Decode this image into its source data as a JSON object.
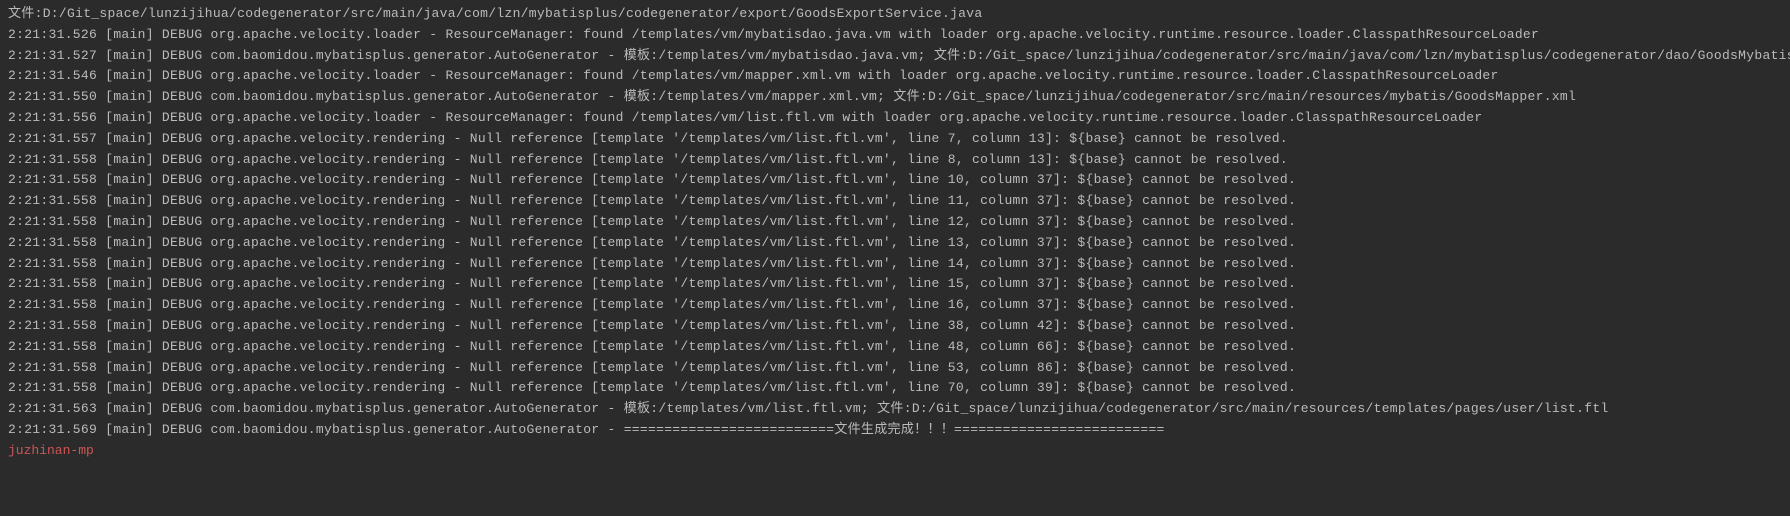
{
  "header": "文件:D:/Git_space/lunzijihua/codegenerator/src/main/java/com/lzn/mybatisplus/codegenerator/export/GoodsExportService.java",
  "lines": [
    "2:21:31.526 [main] DEBUG org.apache.velocity.loader - ResourceManager: found /templates/vm/mybatisdao.java.vm with loader org.apache.velocity.runtime.resource.loader.ClasspathResourceLoader",
    "2:21:31.527 [main] DEBUG com.baomidou.mybatisplus.generator.AutoGenerator - 模板:/templates/vm/mybatisdao.java.vm;  文件:D:/Git_space/lunzijihua/codegenerator/src/main/java/com/lzn/mybatisplus/codegenerator/dao/GoodsMybatis",
    "2:21:31.546 [main] DEBUG org.apache.velocity.loader - ResourceManager: found /templates/vm/mapper.xml.vm with loader org.apache.velocity.runtime.resource.loader.ClasspathResourceLoader",
    "2:21:31.550 [main] DEBUG com.baomidou.mybatisplus.generator.AutoGenerator - 模板:/templates/vm/mapper.xml.vm;  文件:D:/Git_space/lunzijihua/codegenerator/src/main/resources/mybatis/GoodsMapper.xml",
    "2:21:31.556 [main] DEBUG org.apache.velocity.loader - ResourceManager: found /templates/vm/list.ftl.vm with loader org.apache.velocity.runtime.resource.loader.ClasspathResourceLoader",
    "2:21:31.557 [main] DEBUG org.apache.velocity.rendering - Null reference [template '/templates/vm/list.ftl.vm', line 7, column 13]: ${base} cannot be resolved.",
    "2:21:31.558 [main] DEBUG org.apache.velocity.rendering - Null reference [template '/templates/vm/list.ftl.vm', line 8, column 13]: ${base} cannot be resolved.",
    "2:21:31.558 [main] DEBUG org.apache.velocity.rendering - Null reference [template '/templates/vm/list.ftl.vm', line 10, column 37]: ${base} cannot be resolved.",
    "2:21:31.558 [main] DEBUG org.apache.velocity.rendering - Null reference [template '/templates/vm/list.ftl.vm', line 11, column 37]: ${base} cannot be resolved.",
    "2:21:31.558 [main] DEBUG org.apache.velocity.rendering - Null reference [template '/templates/vm/list.ftl.vm', line 12, column 37]: ${base} cannot be resolved.",
    "2:21:31.558 [main] DEBUG org.apache.velocity.rendering - Null reference [template '/templates/vm/list.ftl.vm', line 13, column 37]: ${base} cannot be resolved.",
    "2:21:31.558 [main] DEBUG org.apache.velocity.rendering - Null reference [template '/templates/vm/list.ftl.vm', line 14, column 37]: ${base} cannot be resolved.",
    "2:21:31.558 [main] DEBUG org.apache.velocity.rendering - Null reference [template '/templates/vm/list.ftl.vm', line 15, column 37]: ${base} cannot be resolved.",
    "2:21:31.558 [main] DEBUG org.apache.velocity.rendering - Null reference [template '/templates/vm/list.ftl.vm', line 16, column 37]: ${base} cannot be resolved.",
    "2:21:31.558 [main] DEBUG org.apache.velocity.rendering - Null reference [template '/templates/vm/list.ftl.vm', line 38, column 42]: ${base} cannot be resolved.",
    "2:21:31.558 [main] DEBUG org.apache.velocity.rendering - Null reference [template '/templates/vm/list.ftl.vm', line 48, column 66]: ${base} cannot be resolved.",
    "2:21:31.558 [main] DEBUG org.apache.velocity.rendering - Null reference [template '/templates/vm/list.ftl.vm', line 53, column 86]: ${base} cannot be resolved.",
    "2:21:31.558 [main] DEBUG org.apache.velocity.rendering - Null reference [template '/templates/vm/list.ftl.vm', line 70, column 39]: ${base} cannot be resolved.",
    "2:21:31.563 [main] DEBUG com.baomidou.mybatisplus.generator.AutoGenerator - 模板:/templates/vm/list.ftl.vm;  文件:D:/Git_space/lunzijihua/codegenerator/src/main/resources/templates/pages/user/list.ftl",
    "2:21:31.569 [main] DEBUG com.baomidou.mybatisplus.generator.AutoGenerator - ==========================文件生成完成！！！=========================="
  ],
  "prompt": "juzhinan-mp"
}
